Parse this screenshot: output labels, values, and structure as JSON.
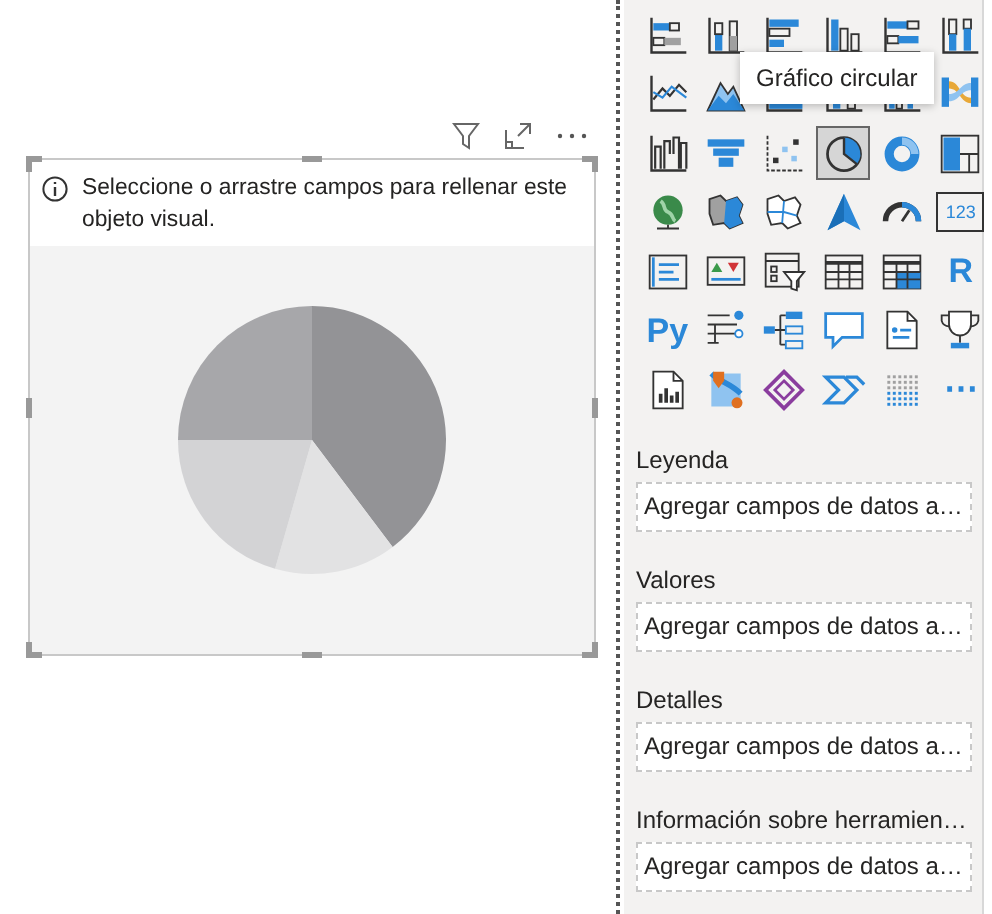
{
  "visual": {
    "message": "Seleccione o arrastre campos para rellenar este objeto visual."
  },
  "visualizations": [
    {
      "kind": "stacked-bar",
      "selected": false
    },
    {
      "kind": "stacked-column",
      "selected": false
    },
    {
      "kind": "clustered-bar",
      "selected": false
    },
    {
      "kind": "clustered-column",
      "selected": false
    },
    {
      "kind": "full-bar",
      "selected": false
    },
    {
      "kind": "full-column",
      "selected": false
    },
    {
      "kind": "line",
      "selected": false
    },
    {
      "kind": "area",
      "selected": false
    },
    {
      "kind": "stacked-area",
      "selected": false
    },
    {
      "kind": "line-column",
      "selected": false
    },
    {
      "kind": "line-clustered",
      "selected": false
    },
    {
      "kind": "ribbon",
      "selected": false
    },
    {
      "kind": "waterfall",
      "selected": false
    },
    {
      "kind": "funnel",
      "selected": false
    },
    {
      "kind": "scatter",
      "selected": false
    },
    {
      "kind": "pie",
      "selected": true
    },
    {
      "kind": "donut",
      "selected": false
    },
    {
      "kind": "treemap",
      "selected": false
    },
    {
      "kind": "globe",
      "selected": false
    },
    {
      "kind": "filled-map",
      "selected": false
    },
    {
      "kind": "shape-map",
      "selected": false
    },
    {
      "kind": "arrow",
      "selected": false
    },
    {
      "kind": "gauge",
      "selected": false
    },
    {
      "kind": "card",
      "label": "123",
      "selected": false
    },
    {
      "kind": "multi-row-card",
      "selected": false
    },
    {
      "kind": "kpi",
      "selected": false
    },
    {
      "kind": "slicer",
      "selected": false
    },
    {
      "kind": "table",
      "selected": false
    },
    {
      "kind": "matrix",
      "selected": false
    },
    {
      "kind": "letter",
      "label": "R",
      "selected": false
    },
    {
      "kind": "letter",
      "label": "Py",
      "selected": false
    },
    {
      "kind": "key-influencers",
      "selected": false
    },
    {
      "kind": "decomposition-tree",
      "selected": false
    },
    {
      "kind": "qa",
      "selected": false
    },
    {
      "kind": "narrative",
      "selected": false
    },
    {
      "kind": "goals",
      "selected": false
    },
    {
      "kind": "paginated",
      "selected": false
    },
    {
      "kind": "arcgis",
      "selected": false
    },
    {
      "kind": "power-apps",
      "selected": false
    },
    {
      "kind": "power-automate",
      "selected": false
    },
    {
      "kind": "dot-grid",
      "selected": false
    },
    {
      "kind": "letter",
      "label": "⋯",
      "selected": false
    }
  ],
  "tooltip": "Gráfico circular",
  "wells": [
    {
      "label": "Leyenda",
      "prompt": "Agregar campos de datos a…"
    },
    {
      "label": "Valores",
      "prompt": "Agregar campos de datos a…"
    },
    {
      "label": "Detalles",
      "prompt": "Agregar campos de datos a…"
    },
    {
      "label": "Información sobre herramien…",
      "prompt": "Agregar campos de datos a…"
    }
  ]
}
